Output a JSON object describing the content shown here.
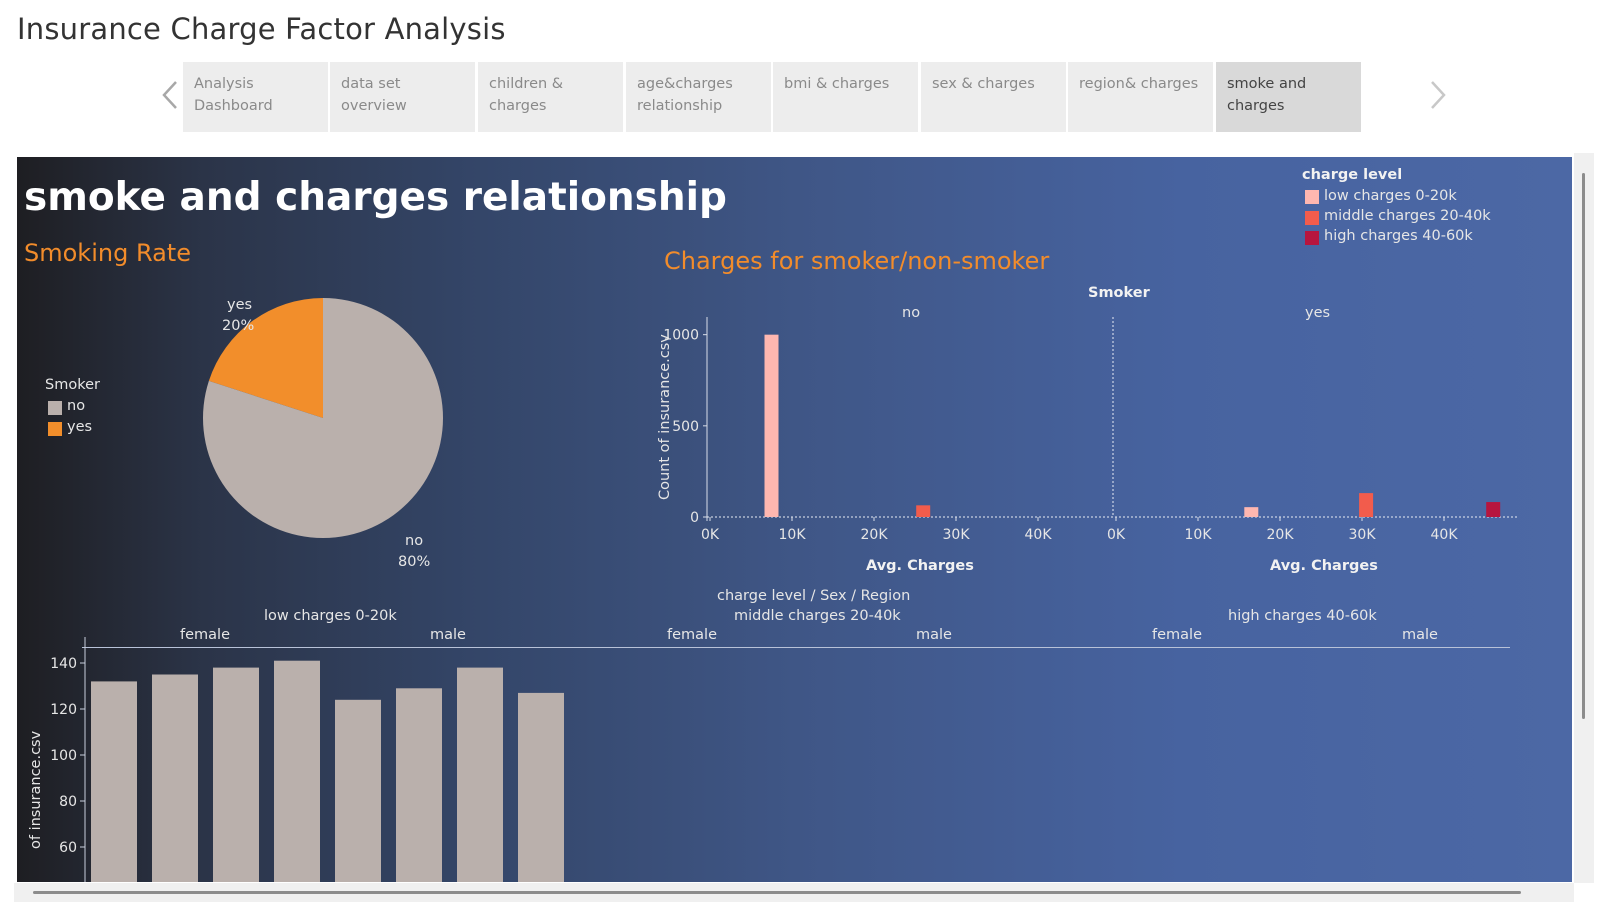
{
  "page_title": "Insurance Charge Factor Analysis",
  "nav": {
    "prev_icon": "chevron-left-icon",
    "next_icon": "chevron-right-icon"
  },
  "tabs": [
    {
      "line1": "Analysis",
      "line2": "Dashboard",
      "active": false
    },
    {
      "line1": "data set overview",
      "line2": "",
      "active": false
    },
    {
      "line1": "children & charges",
      "line2": "",
      "active": false
    },
    {
      "line1": "age&charges",
      "line2": "relationship",
      "active": false
    },
    {
      "line1": "bmi  & charges",
      "line2": "",
      "active": false
    },
    {
      "line1": "sex & charges",
      "line2": "",
      "active": false
    },
    {
      "line1": "region& charges",
      "line2": "",
      "active": false
    },
    {
      "line1": "smoke and",
      "line2": "charges",
      "active": true
    }
  ],
  "dashboard": {
    "title": "smoke and charges relationship",
    "smoking_rate_title": "Smoking Rate",
    "charges_title": "Charges for smoker/non-smoker",
    "smoker_legend": {
      "title": "Smoker",
      "items": [
        {
          "label": "no",
          "color": "#bab0ac"
        },
        {
          "label": "yes",
          "color": "#f28e2b"
        }
      ]
    },
    "charge_level_legend": {
      "title": "charge level",
      "items": [
        {
          "label": "low charges 0-20k",
          "color": "#ffb7b0"
        },
        {
          "label": "middle charges 20-40k",
          "color": "#f25c4c"
        },
        {
          "label": "high charges 40-60k",
          "color": "#b7153e"
        }
      ]
    },
    "pie_labels": {
      "yes_name": "yes",
      "yes_pct": "20%",
      "no_name": "no",
      "no_pct": "80%"
    },
    "histogram": {
      "column_header": "Smoker",
      "panels": [
        "no",
        "yes"
      ],
      "y_axis_label": "Count of insurance.csv",
      "x_axis_label": "Avg. Charges",
      "y_ticks": [
        "1000",
        "500",
        "0"
      ],
      "x_ticks": [
        "0K",
        "10K",
        "20K",
        "30K",
        "40K"
      ]
    },
    "bar_panel": {
      "header": "charge level  /  Sex  /  Region",
      "levels": [
        "low charges 0-20k",
        "middle charges 20-40k",
        "high charges 40-60k"
      ],
      "sexes": [
        "female",
        "male",
        "female",
        "male",
        "female",
        "male"
      ],
      "y_axis_label": "of insurance.csv",
      "y_ticks": [
        "140",
        "120",
        "100",
        "80",
        "60"
      ]
    }
  },
  "chart_data": [
    {
      "type": "pie",
      "title": "Smoking Rate",
      "categories": [
        "no",
        "yes"
      ],
      "values": [
        80,
        20
      ],
      "colors": [
        "#bab0ac",
        "#f28e2b"
      ],
      "legend": "left"
    },
    {
      "type": "bar",
      "title": "Charges for smoker/non-smoker",
      "panels": [
        "no",
        "yes"
      ],
      "xlabel": "Avg. Charges",
      "ylabel": "Count of insurance.csv",
      "xlim": [
        0,
        47000
      ],
      "ylim": [
        0,
        1064
      ],
      "legend": "top-right",
      "series": [
        {
          "name": "low charges 0-20k",
          "color": "#ffb7b0",
          "points": [
            {
              "panel": "no",
              "x": 7500,
              "y": 1000
            },
            {
              "panel": "yes",
              "x": 16500,
              "y": 54
            }
          ]
        },
        {
          "name": "middle charges 20-40k",
          "color": "#f25c4c",
          "points": [
            {
              "panel": "no",
              "x": 26000,
              "y": 64
            },
            {
              "panel": "yes",
              "x": 30500,
              "y": 131
            }
          ]
        },
        {
          "name": "high charges 40-60k",
          "color": "#b7153e",
          "points": [
            {
              "panel": "yes",
              "x": 46000,
              "y": 82
            }
          ]
        }
      ]
    },
    {
      "type": "bar",
      "title": "",
      "ylabel": "Count of insurance.csv",
      "ylim": [
        60,
        150
      ],
      "categories": [
        "low charges 0-20k / female / 1",
        "low charges 0-20k / female / 2",
        "low charges 0-20k / female / 3",
        "low charges 0-20k / female / 4",
        "low charges 0-20k / male / 1",
        "low charges 0-20k / male / 2",
        "low charges 0-20k / male / 3",
        "low charges 0-20k / male / 4"
      ],
      "values": [
        132,
        135,
        138,
        141,
        124,
        129,
        138,
        127
      ],
      "color": "#bab0ac"
    }
  ]
}
